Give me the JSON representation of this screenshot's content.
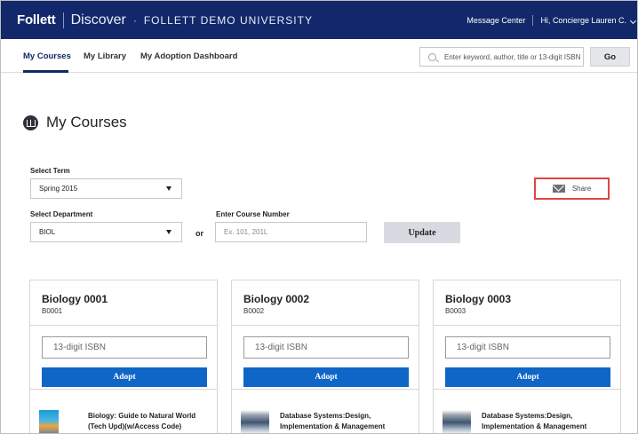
{
  "header": {
    "logo": "Follett",
    "product": "Discover",
    "separator_dot": "·",
    "school": "FOLLETT DEMO UNIVERSITY",
    "message_center": "Message Center",
    "user_greeting": "Hi, Concierge Lauren C."
  },
  "nav": {
    "tabs": [
      {
        "label": "My Courses",
        "active": true
      },
      {
        "label": "My Library",
        "active": false
      },
      {
        "label": "My Adoption Dashboard",
        "active": false
      }
    ],
    "search_placeholder": "Enter keyword, author, title or 13-digit ISBN",
    "go_label": "Go"
  },
  "page": {
    "title": "My Courses"
  },
  "filters": {
    "term_label": "Select Term",
    "term_value": "Spring 2015",
    "department_label": "Select Department",
    "department_value": "BIOL",
    "or_label": "or",
    "course_number_label": "Enter Course Number",
    "course_number_placeholder": "Ex. 101, 201L",
    "update_label": "Update",
    "share_label": "Share"
  },
  "courses": [
    {
      "title": "Biology 0001",
      "code": "B0001",
      "isbn_placeholder": "13-digit ISBN",
      "adopt_label": "Adopt",
      "book_title": "Biology: Guide to Natural World (Tech Upd)(w/Access Code)"
    },
    {
      "title": "Biology 0002",
      "code": "B0002",
      "isbn_placeholder": "13-digit ISBN",
      "adopt_label": "Adopt",
      "book_title": "Database Systems:Design, Implementation & Management"
    },
    {
      "title": "Biology 0003",
      "code": "B0003",
      "isbn_placeholder": "13-digit ISBN",
      "adopt_label": "Adopt",
      "book_title": "Database Systems:Design, Implementation & Management"
    }
  ],
  "colors": {
    "header_bg": "#12286a",
    "adopt_button": "#0f66c7",
    "share_highlight": "#e0453f"
  }
}
